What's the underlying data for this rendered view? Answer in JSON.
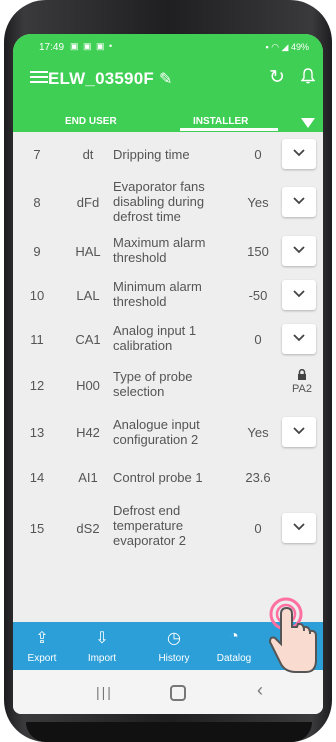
{
  "status_bar": {
    "time": "17:49",
    "left_icons": "▣ ▣ ▣ •",
    "right_text": "49%"
  },
  "app_bar": {
    "title": "ELW_03590F",
    "menu_icon": "menu-icon",
    "edit_icon": "pencil-icon",
    "refresh_icon": "refresh-icon",
    "bell_icon": "bell-icon"
  },
  "tabs": {
    "end_user": "END USER",
    "installer": "INSTALLER"
  },
  "params": [
    {
      "num": "7",
      "code": "dt",
      "desc": "Dripping time",
      "value": "0",
      "control": "dropdown"
    },
    {
      "num": "8",
      "code": "dFd",
      "desc": "Evaporator fans disabling during defrost time",
      "value": "Yes",
      "control": "dropdown"
    },
    {
      "num": "9",
      "code": "HAL",
      "desc": "Maximum alarm threshold",
      "value": "150",
      "control": "dropdown"
    },
    {
      "num": "10",
      "code": "LAL",
      "desc": "Minimum alarm threshold",
      "value": "-50",
      "control": "dropdown"
    },
    {
      "num": "11",
      "code": "CA1",
      "desc": "Analog input 1 calibration",
      "value": "0",
      "control": "dropdown"
    },
    {
      "num": "12",
      "code": "H00",
      "desc": "Type of probe selection",
      "value": "",
      "control": "lock",
      "lock_label": "PA2"
    },
    {
      "num": "13",
      "code": "H42",
      "desc": "Analogue input configuration 2",
      "value": "Yes",
      "control": "dropdown"
    },
    {
      "num": "14",
      "code": "AI1",
      "desc": "Control probe 1",
      "value": "23.6",
      "control": "none"
    },
    {
      "num": "15",
      "code": "dS2",
      "desc": "Defrost end temperature evaporator 2",
      "value": "0",
      "control": "dropdown"
    }
  ],
  "bottom_nav": [
    {
      "label": "Export",
      "icon": "export-icon"
    },
    {
      "label": "Import",
      "icon": "import-icon"
    },
    {
      "label": "History",
      "icon": "history-icon"
    },
    {
      "label": "Datalog",
      "icon": "datalog-icon"
    }
  ],
  "colors": {
    "app_green": "#3fcf54",
    "nav_blue": "#2c9fd8",
    "row_bg": "#eeeeee"
  }
}
